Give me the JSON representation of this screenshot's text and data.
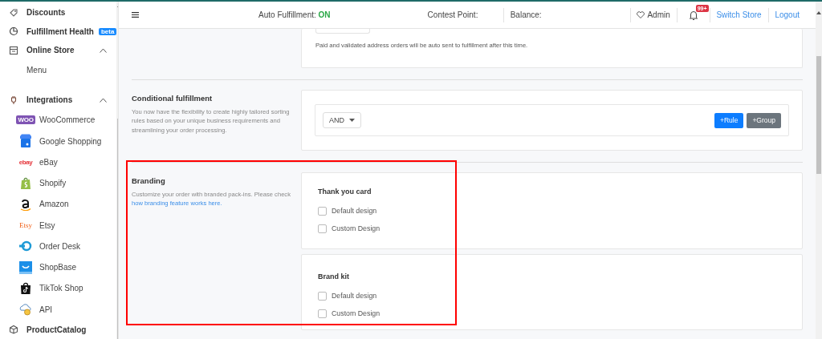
{
  "sidebar": {
    "items": [
      {
        "kind": "link",
        "label": "Discounts"
      },
      {
        "kind": "link",
        "label": "Fulfillment Health",
        "badge": "beta"
      },
      {
        "kind": "group",
        "label": "Online Store",
        "expanded": true,
        "children": [
          {
            "label": "Menu"
          }
        ]
      },
      {
        "kind": "group",
        "label": "Integrations",
        "expanded": true,
        "children": [
          {
            "label": "WooCommerce",
            "logo_text": "WOO"
          },
          {
            "label": "Google Shopping"
          },
          {
            "label": "eBay",
            "logo_text": "ebay"
          },
          {
            "label": "Shopify"
          },
          {
            "label": "Amazon"
          },
          {
            "label": "Etsy",
            "logo_text": "Etsy"
          },
          {
            "label": "Order Desk"
          },
          {
            "label": "ShopBase"
          },
          {
            "label": "TikTok Shop"
          },
          {
            "label": "API"
          }
        ]
      },
      {
        "kind": "link",
        "label": "ProductCatalog"
      }
    ]
  },
  "header": {
    "auto_fulfillment": {
      "label": "Auto Fulfillment:",
      "value": "ON",
      "on": true
    },
    "contest_point": {
      "label": "Contest Point:"
    },
    "balance": {
      "label": "Balance:"
    },
    "user": {
      "label": "Admin"
    },
    "notifications": {
      "badge": "99+"
    },
    "links": [
      "Switch Store",
      "Logout"
    ]
  },
  "sections": [
    {
      "kind": "delay",
      "note": "Paid and validated address orders will be auto sent to fulfillment after this time."
    },
    {
      "kind": "conditional",
      "title": "Conditional fulfillment",
      "description": "You now have the flexibility to create highly tailored sorting rules based on your unique business requirements and streamlining your order processing.",
      "operator": "AND",
      "buttons": [
        {
          "label": "+Rule",
          "kind": "primary"
        },
        {
          "label": "+Group",
          "kind": "secondary"
        }
      ]
    },
    {
      "kind": "branding",
      "title": "Branding",
      "description": "Customize your order with branded pack-ins. Please check",
      "link": "how branding feature works here.",
      "groups": [
        {
          "title": "Thank you card",
          "options": [
            {
              "label": "Default design",
              "checked": false
            },
            {
              "label": "Custom Design",
              "checked": false
            }
          ]
        },
        {
          "title": "Brand kit",
          "options": [
            {
              "label": "Default design",
              "checked": false
            },
            {
              "label": "Custom Design",
              "checked": false
            }
          ]
        }
      ]
    }
  ]
}
